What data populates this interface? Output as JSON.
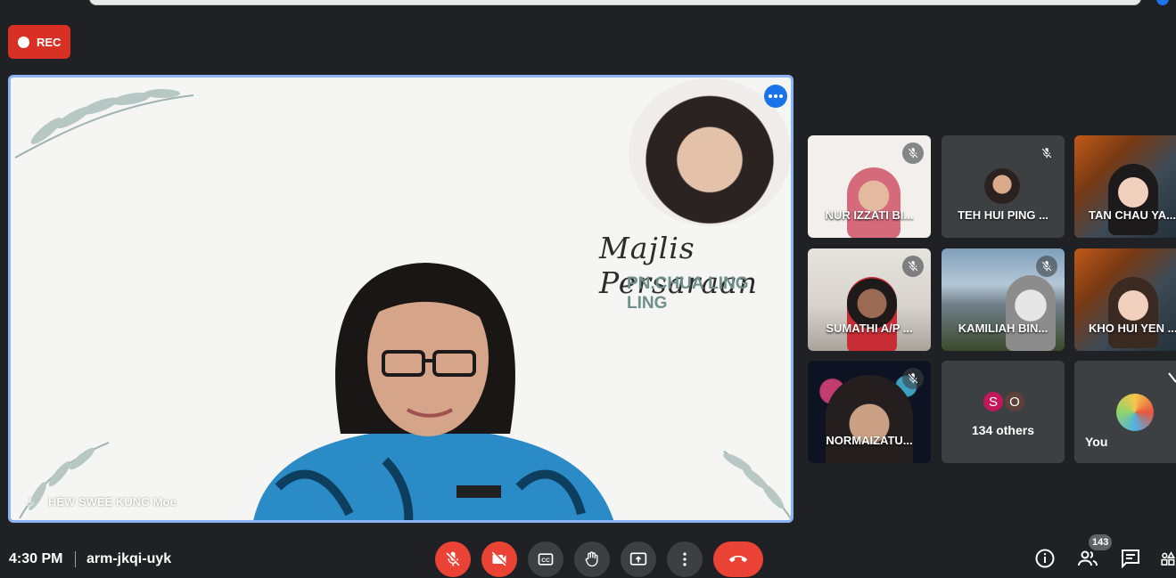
{
  "recording": {
    "label": "REC"
  },
  "main_tile": {
    "banner_title": "Majlis Persaraan",
    "banner_subtitle": "PN.CHUA LING LING",
    "speaker_name": "HEW SWEE KUNG Moe"
  },
  "participants": [
    {
      "name": "NUR IZZATI BI...",
      "muted": true
    },
    {
      "name": "TEH HUI PING ...",
      "muted": true
    },
    {
      "name": "TAN CHAU YA...",
      "muted": false
    },
    {
      "name": "SUMATHI A/P ...",
      "muted": true
    },
    {
      "name": "KAMILIAH BIN...",
      "muted": true
    },
    {
      "name": "KHO HUI YEN ...",
      "muted": false
    },
    {
      "name": "NORMAIZATU...",
      "muted": true
    }
  ],
  "others_tile": {
    "chips": [
      "S",
      "O"
    ],
    "label": "134 others"
  },
  "self_tile": {
    "name": "You"
  },
  "bottom_bar": {
    "time": "4:30 PM",
    "meeting_code": "arm-jkqi-uyk",
    "people_count": "143"
  },
  "colors": {
    "accent": "#8ab4f8",
    "danger": "#ea4335",
    "rec": "#d93025",
    "bg": "#202124",
    "tile": "#3c4043",
    "chip_s": "#c2185b",
    "chip_o": "#5d4037"
  }
}
